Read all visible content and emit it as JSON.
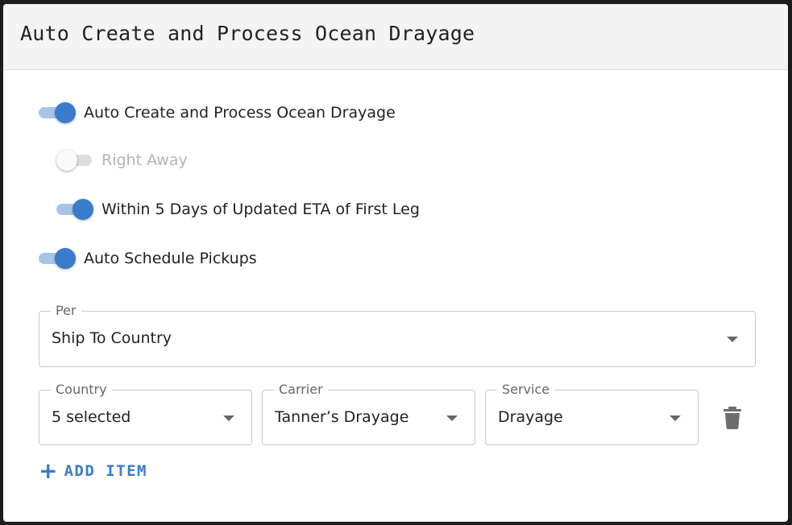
{
  "dialog": {
    "title": "Auto Create and Process Ocean Drayage"
  },
  "toggles": {
    "auto_create": {
      "label": "Auto Create and Process Ocean Drayage",
      "checked": true
    },
    "right_away": {
      "label": "Right Away",
      "checked": false,
      "disabled": true
    },
    "within_days": {
      "label": "Within 5 Days of Updated ETA of First Leg",
      "checked": true
    },
    "auto_schedule": {
      "label": "Auto Schedule Pickups",
      "checked": true
    }
  },
  "per_select": {
    "label": "Per",
    "value": "Ship To Country",
    "icon": "chevron-down-icon"
  },
  "item_row": {
    "country": {
      "label": "Country",
      "value": "5 selected"
    },
    "carrier": {
      "label": "Carrier",
      "value": "Tanner’s Drayage"
    },
    "service": {
      "label": "Service",
      "value": "Drayage"
    },
    "delete_icon": "trash-icon"
  },
  "add_item": {
    "label": "ADD ITEM",
    "icon": "plus-icon"
  },
  "colors": {
    "accent": "#3a7bcc",
    "accent_light": "#a7c4e8",
    "header_bg": "#f4f4f4",
    "disabled_text": "#b5b5b5"
  }
}
